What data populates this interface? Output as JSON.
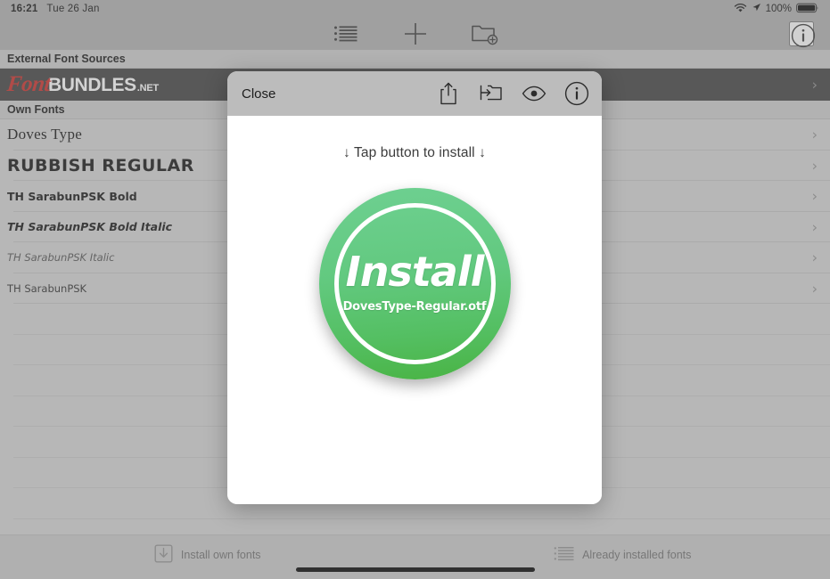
{
  "statusbar": {
    "time": "16:21",
    "date": "Tue 26 Jan",
    "battery_percent": "100%",
    "wifi_icon": "wifi-icon",
    "location_icon": "location-arrow-icon",
    "battery_icon": "battery-full-icon"
  },
  "toolbar": {
    "list_icon": "bulleted-list-icon",
    "add_icon": "plus-icon",
    "add_folder_icon": "folder-add-icon",
    "info_icon": "info-circle-icon"
  },
  "list": {
    "external_header": "External Font Sources",
    "own_header": "Own Fonts",
    "banner": {
      "logo_script": "Font",
      "logo_bold": "BUNDLES",
      "logo_tld": ".NET",
      "chevron": "›"
    },
    "chevron": "›",
    "fonts": [
      {
        "name": "Doves Type",
        "style": "f-doves"
      },
      {
        "name": "RUBBISH REGULAR",
        "style": "f-rubbish"
      },
      {
        "name": "TH SarabunPSK Bold",
        "style": "f-sbold"
      },
      {
        "name": "TH SarabunPSK Bold Italic",
        "style": "f-sbolditalic"
      },
      {
        "name": "TH SarabunPSK Italic",
        "style": "f-sitalic"
      },
      {
        "name": "TH SarabunPSK",
        "style": "f-sreg"
      }
    ],
    "empty_row_count": 8
  },
  "modal": {
    "close_label": "Close",
    "share_icon": "share-icon",
    "move_to_folder_icon": "folder-arrow-icon",
    "preview_icon": "eye-icon",
    "info_icon": "info-circle-icon",
    "hint": "↓ Tap button to install ↓",
    "install_label": "Install",
    "install_filename": "DovesType-Regular.otf"
  },
  "tabbar": {
    "items": [
      {
        "label": "Install own fonts",
        "icon": "download-box-icon"
      },
      {
        "label": "Already installed fonts",
        "icon": "bulleted-list-icon"
      }
    ]
  },
  "colors": {
    "install_green": "#5FCC87",
    "install_green_dark": "#49B343",
    "brand_red": "#C2302B",
    "banner_bg": "#434343"
  }
}
